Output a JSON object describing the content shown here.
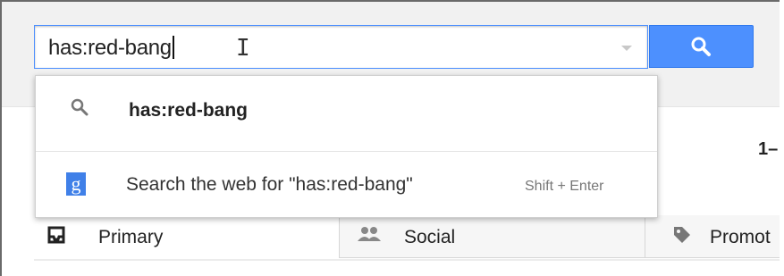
{
  "search": {
    "value": "has:red-bang"
  },
  "suggestions": {
    "query_item": "has:red-bang",
    "web_item": "Search the web for \"has:red-bang\"",
    "web_shortcut": "Shift + Enter"
  },
  "pagination": {
    "text": "1–"
  },
  "tabs": [
    {
      "label": "Primary",
      "icon": "inbox-icon"
    },
    {
      "label": "Social",
      "icon": "people-icon"
    },
    {
      "label": "Promot",
      "icon": "tag-icon"
    }
  ],
  "colors": {
    "accent": "#4d90fe",
    "google_plus": "#4080e8"
  }
}
